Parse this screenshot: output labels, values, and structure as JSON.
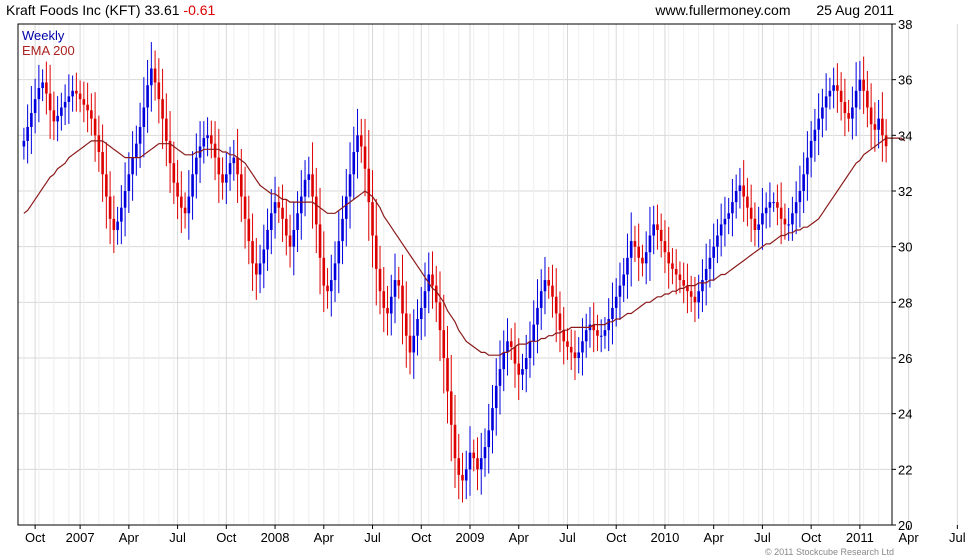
{
  "header": {
    "title": "Kraft Foods Inc (KFT)",
    "last": "33.61",
    "change": "-0.61",
    "site": "www.fullermoney.com",
    "date": "25 Aug 2011"
  },
  "footer": {
    "copyright": "© 2011 Stockcube Research Ltd"
  },
  "colors": {
    "up": "#0000dd",
    "down": "#dd0000",
    "ema": "#8b1a1a",
    "grid": "#d8d8d8"
  },
  "chart_data": {
    "type": "line",
    "series": [
      {
        "name": "Weekly",
        "kind": "ohlc-bars"
      },
      {
        "name": "EMA 200",
        "kind": "line"
      }
    ],
    "ylim": [
      20,
      38
    ],
    "yticks": [
      20,
      22,
      24,
      26,
      28,
      30,
      32,
      34,
      36,
      38
    ],
    "xticks": [
      "Oct",
      "2007",
      "Apr",
      "Jul",
      "Oct",
      "2008",
      "Apr",
      "Jul",
      "Oct",
      "2009",
      "Apr",
      "Jul",
      "Oct",
      "2010",
      "Apr",
      "Jul",
      "Oct",
      "2011",
      "Apr",
      "Jul"
    ],
    "xtick_index": [
      3,
      15,
      28,
      41,
      54,
      67,
      80,
      93,
      106,
      119,
      132,
      145,
      158,
      171,
      184,
      197,
      210,
      223,
      236,
      249
    ],
    "closes": [
      33.8,
      34.3,
      34.8,
      35.3,
      35.7,
      35.9,
      35.5,
      34.9,
      34.5,
      34.7,
      35.0,
      35.2,
      35.4,
      35.6,
      35.5,
      35.3,
      35.1,
      34.9,
      34.6,
      34.0,
      33.4,
      32.6,
      31.8,
      31.0,
      30.6,
      30.9,
      31.4,
      32.0,
      32.6,
      33.2,
      33.7,
      34.3,
      35.0,
      35.8,
      36.4,
      35.9,
      35.3,
      34.6,
      33.8,
      33.0,
      32.3,
      31.8,
      31.4,
      31.2,
      31.8,
      32.6,
      33.2,
      33.6,
      33.9,
      34.0,
      33.7,
      33.2,
      32.6,
      32.3,
      32.6,
      33.0,
      33.2,
      32.6,
      31.8,
      31.0,
      30.2,
      29.4,
      29.0,
      29.4,
      29.9,
      30.6,
      31.2,
      31.6,
      31.4,
      31.0,
      30.4,
      30.0,
      30.6,
      31.2,
      31.8,
      32.4,
      32.6,
      31.8,
      30.8,
      29.6,
      28.6,
      28.4,
      28.8,
      29.4,
      30.2,
      31.0,
      31.8,
      32.6,
      33.4,
      34.0,
      33.6,
      32.8,
      31.6,
      30.4,
      29.2,
      28.4,
      27.8,
      27.6,
      28.2,
      28.8,
      28.6,
      27.6,
      26.8,
      26.2,
      26.8,
      27.4,
      27.8,
      28.4,
      29.0,
      28.6,
      28.0,
      27.0,
      26.0,
      24.8,
      23.6,
      22.4,
      21.8,
      21.6,
      22.0,
      22.6,
      22.4,
      22.0,
      22.4,
      22.8,
      23.4,
      24.2,
      25.0,
      25.6,
      26.2,
      26.6,
      26.4,
      25.8,
      25.4,
      25.6,
      26.0,
      26.6,
      27.2,
      27.8,
      28.4,
      28.8,
      28.6,
      28.2,
      27.6,
      27.0,
      26.6,
      26.4,
      26.2,
      26.0,
      26.2,
      26.6,
      27.0,
      27.2,
      27.0,
      26.8,
      26.8,
      27.0,
      27.4,
      27.8,
      28.2,
      28.6,
      29.0,
      29.6,
      30.2,
      30.0,
      29.6,
      29.4,
      29.8,
      30.4,
      30.8,
      30.6,
      30.2,
      29.8,
      29.4,
      29.2,
      29.0,
      28.8,
      28.6,
      28.4,
      28.2,
      28.0,
      28.4,
      28.8,
      29.2,
      29.6,
      30.0,
      30.4,
      30.8,
      31.0,
      31.2,
      31.6,
      32.0,
      32.2,
      31.8,
      31.4,
      31.0,
      30.6,
      30.8,
      31.2,
      31.4,
      31.6,
      31.6,
      31.4,
      31.0,
      30.8,
      30.8,
      31.2,
      31.6,
      32.0,
      32.6,
      33.2,
      33.8,
      34.2,
      34.6,
      35.0,
      35.4,
      35.6,
      35.8,
      35.6,
      35.2,
      34.8,
      34.6,
      35.0,
      35.6,
      36.0,
      35.6,
      35.0,
      34.4,
      34.2,
      34.6,
      34.0,
      33.61
    ],
    "ema": [
      31.2,
      31.3,
      31.5,
      31.7,
      31.9,
      32.1,
      32.3,
      32.5,
      32.6,
      32.8,
      32.9,
      33.0,
      33.2,
      33.3,
      33.4,
      33.5,
      33.6,
      33.7,
      33.8,
      33.8,
      33.8,
      33.8,
      33.7,
      33.6,
      33.5,
      33.4,
      33.3,
      33.2,
      33.2,
      33.2,
      33.2,
      33.2,
      33.3,
      33.4,
      33.5,
      33.6,
      33.7,
      33.7,
      33.7,
      33.7,
      33.6,
      33.5,
      33.4,
      33.3,
      33.3,
      33.3,
      33.4,
      33.4,
      33.5,
      33.5,
      33.5,
      33.5,
      33.5,
      33.4,
      33.4,
      33.3,
      33.3,
      33.2,
      33.1,
      33.0,
      32.8,
      32.6,
      32.4,
      32.2,
      32.1,
      32.0,
      31.9,
      31.9,
      31.8,
      31.7,
      31.7,
      31.6,
      31.6,
      31.6,
      31.6,
      31.6,
      31.6,
      31.6,
      31.5,
      31.4,
      31.3,
      31.2,
      31.2,
      31.2,
      31.3,
      31.4,
      31.5,
      31.6,
      31.7,
      31.8,
      31.9,
      32.0,
      31.9,
      31.8,
      31.6,
      31.4,
      31.1,
      30.9,
      30.7,
      30.5,
      30.3,
      30.1,
      29.9,
      29.7,
      29.5,
      29.3,
      29.1,
      28.9,
      28.7,
      28.5,
      28.4,
      28.2,
      28.0,
      27.7,
      27.5,
      27.3,
      27.0,
      26.8,
      26.6,
      26.5,
      26.4,
      26.3,
      26.2,
      26.2,
      26.1,
      26.1,
      26.1,
      26.1,
      26.2,
      26.2,
      26.3,
      26.4,
      26.5,
      26.5,
      26.5,
      26.6,
      26.6,
      26.6,
      26.7,
      26.7,
      26.8,
      26.8,
      26.9,
      26.9,
      27.0,
      27.0,
      27.1,
      27.1,
      27.1,
      27.1,
      27.1,
      27.1,
      27.2,
      27.2,
      27.2,
      27.2,
      27.3,
      27.3,
      27.4,
      27.4,
      27.5,
      27.6,
      27.6,
      27.7,
      27.8,
      27.9,
      28.0,
      28.0,
      28.1,
      28.2,
      28.2,
      28.3,
      28.3,
      28.4,
      28.4,
      28.5,
      28.5,
      28.6,
      28.6,
      28.6,
      28.7,
      28.7,
      28.7,
      28.8,
      28.8,
      28.9,
      29.0,
      29.0,
      29.1,
      29.2,
      29.3,
      29.4,
      29.5,
      29.6,
      29.7,
      29.8,
      29.9,
      30.0,
      30.1,
      30.1,
      30.2,
      30.3,
      30.4,
      30.4,
      30.5,
      30.5,
      30.6,
      30.6,
      30.7,
      30.7,
      30.8,
      30.9,
      31.0,
      31.2,
      31.4,
      31.6,
      31.8,
      32.0,
      32.2,
      32.4,
      32.6,
      32.8,
      33.0,
      33.1,
      33.3,
      33.4,
      33.5,
      33.6,
      33.7,
      33.8,
      33.9,
      33.9,
      33.9,
      33.9,
      33.9,
      33.8
    ]
  }
}
